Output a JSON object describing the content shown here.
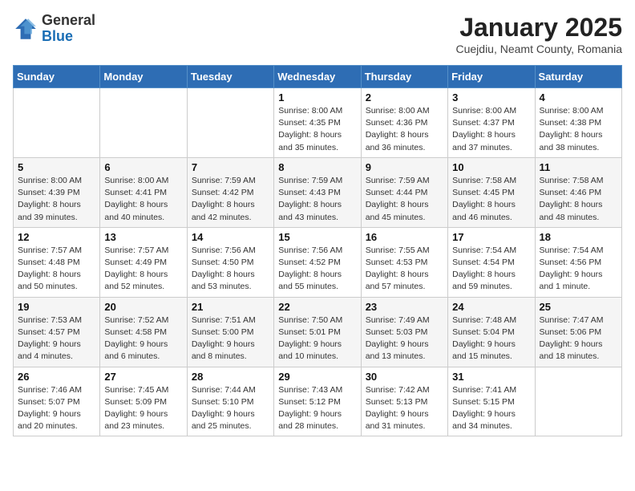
{
  "logo": {
    "general": "General",
    "blue": "Blue"
  },
  "header": {
    "title": "January 2025",
    "location": "Cuejdiu, Neamt County, Romania"
  },
  "weekdays": [
    "Sunday",
    "Monday",
    "Tuesday",
    "Wednesday",
    "Thursday",
    "Friday",
    "Saturday"
  ],
  "weeks": [
    [
      {
        "day": "",
        "info": ""
      },
      {
        "day": "",
        "info": ""
      },
      {
        "day": "",
        "info": ""
      },
      {
        "day": "1",
        "info": "Sunrise: 8:00 AM\nSunset: 4:35 PM\nDaylight: 8 hours\nand 35 minutes."
      },
      {
        "day": "2",
        "info": "Sunrise: 8:00 AM\nSunset: 4:36 PM\nDaylight: 8 hours\nand 36 minutes."
      },
      {
        "day": "3",
        "info": "Sunrise: 8:00 AM\nSunset: 4:37 PM\nDaylight: 8 hours\nand 37 minutes."
      },
      {
        "day": "4",
        "info": "Sunrise: 8:00 AM\nSunset: 4:38 PM\nDaylight: 8 hours\nand 38 minutes."
      }
    ],
    [
      {
        "day": "5",
        "info": "Sunrise: 8:00 AM\nSunset: 4:39 PM\nDaylight: 8 hours\nand 39 minutes."
      },
      {
        "day": "6",
        "info": "Sunrise: 8:00 AM\nSunset: 4:41 PM\nDaylight: 8 hours\nand 40 minutes."
      },
      {
        "day": "7",
        "info": "Sunrise: 7:59 AM\nSunset: 4:42 PM\nDaylight: 8 hours\nand 42 minutes."
      },
      {
        "day": "8",
        "info": "Sunrise: 7:59 AM\nSunset: 4:43 PM\nDaylight: 8 hours\nand 43 minutes."
      },
      {
        "day": "9",
        "info": "Sunrise: 7:59 AM\nSunset: 4:44 PM\nDaylight: 8 hours\nand 45 minutes."
      },
      {
        "day": "10",
        "info": "Sunrise: 7:58 AM\nSunset: 4:45 PM\nDaylight: 8 hours\nand 46 minutes."
      },
      {
        "day": "11",
        "info": "Sunrise: 7:58 AM\nSunset: 4:46 PM\nDaylight: 8 hours\nand 48 minutes."
      }
    ],
    [
      {
        "day": "12",
        "info": "Sunrise: 7:57 AM\nSunset: 4:48 PM\nDaylight: 8 hours\nand 50 minutes."
      },
      {
        "day": "13",
        "info": "Sunrise: 7:57 AM\nSunset: 4:49 PM\nDaylight: 8 hours\nand 52 minutes."
      },
      {
        "day": "14",
        "info": "Sunrise: 7:56 AM\nSunset: 4:50 PM\nDaylight: 8 hours\nand 53 minutes."
      },
      {
        "day": "15",
        "info": "Sunrise: 7:56 AM\nSunset: 4:52 PM\nDaylight: 8 hours\nand 55 minutes."
      },
      {
        "day": "16",
        "info": "Sunrise: 7:55 AM\nSunset: 4:53 PM\nDaylight: 8 hours\nand 57 minutes."
      },
      {
        "day": "17",
        "info": "Sunrise: 7:54 AM\nSunset: 4:54 PM\nDaylight: 8 hours\nand 59 minutes."
      },
      {
        "day": "18",
        "info": "Sunrise: 7:54 AM\nSunset: 4:56 PM\nDaylight: 9 hours\nand 1 minute."
      }
    ],
    [
      {
        "day": "19",
        "info": "Sunrise: 7:53 AM\nSunset: 4:57 PM\nDaylight: 9 hours\nand 4 minutes."
      },
      {
        "day": "20",
        "info": "Sunrise: 7:52 AM\nSunset: 4:58 PM\nDaylight: 9 hours\nand 6 minutes."
      },
      {
        "day": "21",
        "info": "Sunrise: 7:51 AM\nSunset: 5:00 PM\nDaylight: 9 hours\nand 8 minutes."
      },
      {
        "day": "22",
        "info": "Sunrise: 7:50 AM\nSunset: 5:01 PM\nDaylight: 9 hours\nand 10 minutes."
      },
      {
        "day": "23",
        "info": "Sunrise: 7:49 AM\nSunset: 5:03 PM\nDaylight: 9 hours\nand 13 minutes."
      },
      {
        "day": "24",
        "info": "Sunrise: 7:48 AM\nSunset: 5:04 PM\nDaylight: 9 hours\nand 15 minutes."
      },
      {
        "day": "25",
        "info": "Sunrise: 7:47 AM\nSunset: 5:06 PM\nDaylight: 9 hours\nand 18 minutes."
      }
    ],
    [
      {
        "day": "26",
        "info": "Sunrise: 7:46 AM\nSunset: 5:07 PM\nDaylight: 9 hours\nand 20 minutes."
      },
      {
        "day": "27",
        "info": "Sunrise: 7:45 AM\nSunset: 5:09 PM\nDaylight: 9 hours\nand 23 minutes."
      },
      {
        "day": "28",
        "info": "Sunrise: 7:44 AM\nSunset: 5:10 PM\nDaylight: 9 hours\nand 25 minutes."
      },
      {
        "day": "29",
        "info": "Sunrise: 7:43 AM\nSunset: 5:12 PM\nDaylight: 9 hours\nand 28 minutes."
      },
      {
        "day": "30",
        "info": "Sunrise: 7:42 AM\nSunset: 5:13 PM\nDaylight: 9 hours\nand 31 minutes."
      },
      {
        "day": "31",
        "info": "Sunrise: 7:41 AM\nSunset: 5:15 PM\nDaylight: 9 hours\nand 34 minutes."
      },
      {
        "day": "",
        "info": ""
      }
    ]
  ]
}
